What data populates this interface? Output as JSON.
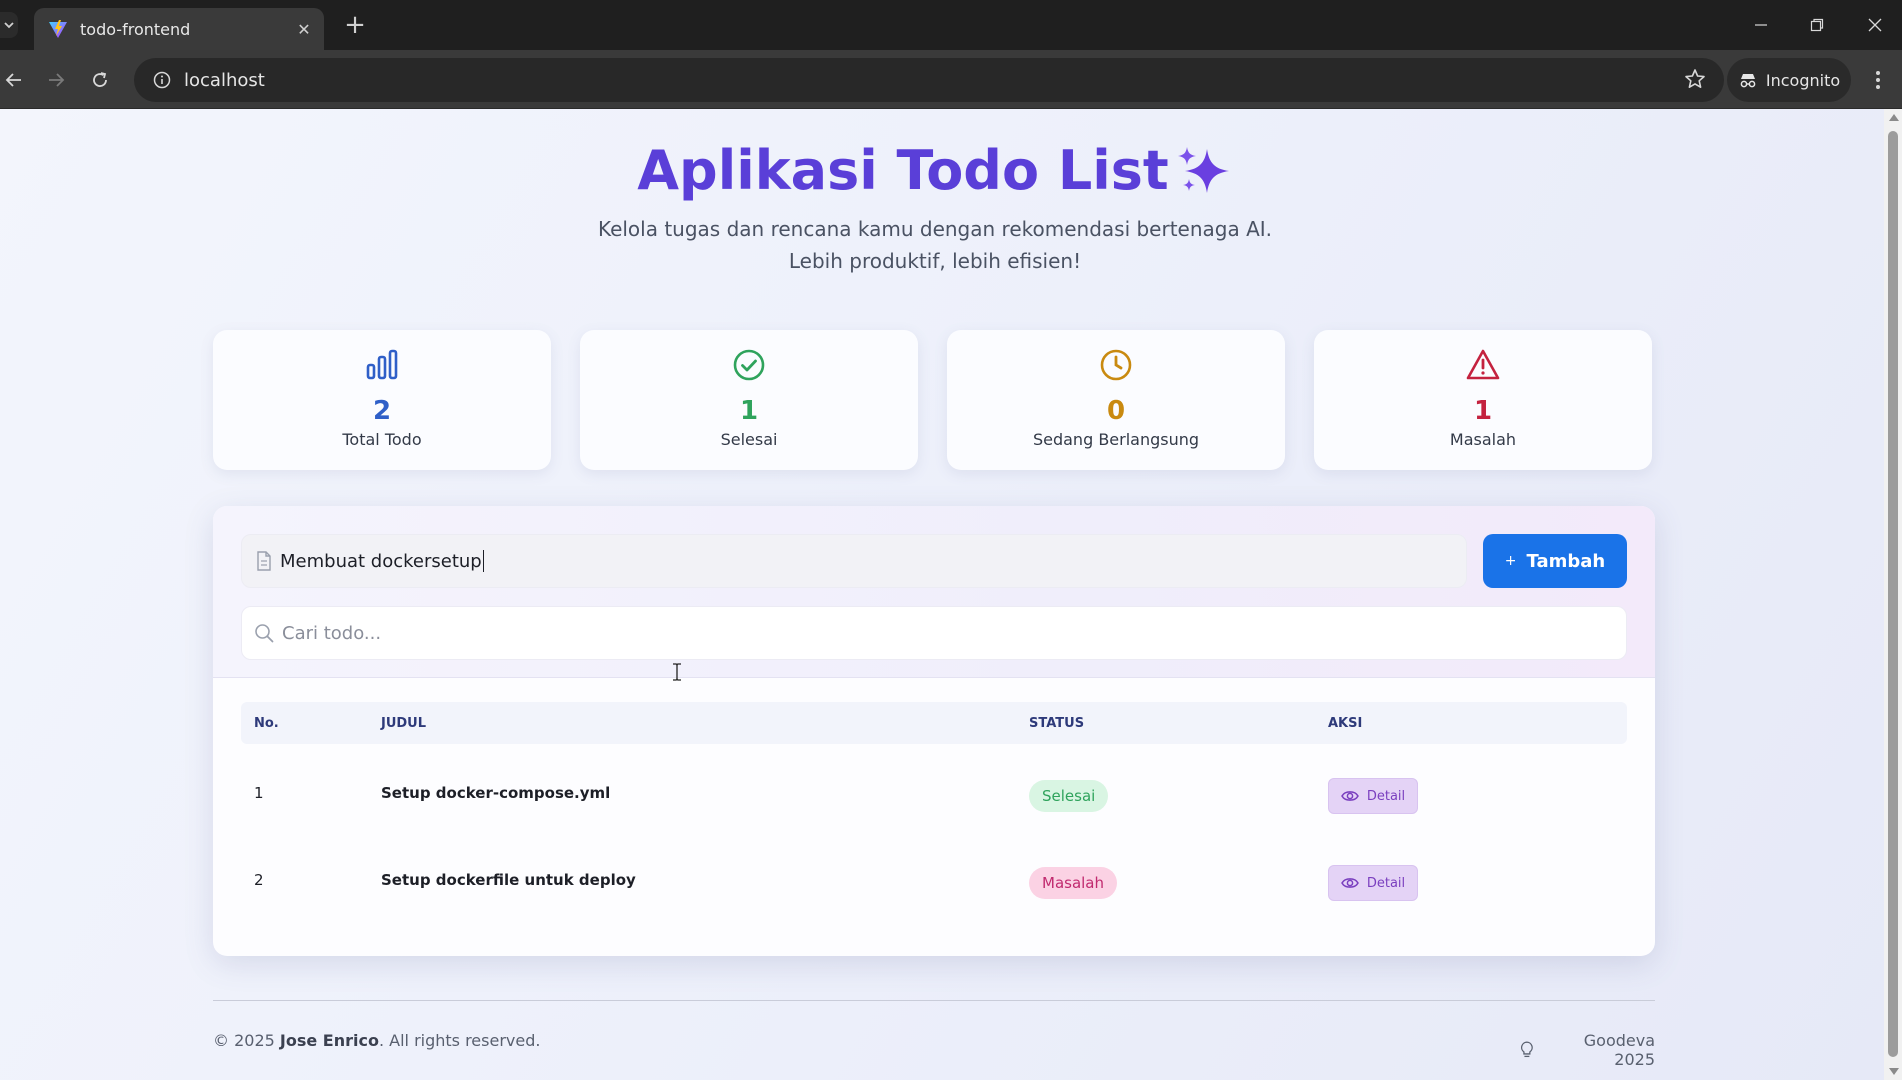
{
  "browser": {
    "tab_title": "todo-frontend",
    "url": "localhost",
    "incognito_label": "Incognito"
  },
  "hero": {
    "title": "Aplikasi Todo List",
    "subtitle": "Kelola tugas dan rencana kamu dengan rekomendasi bertenaga AI. Lebih produktif, lebih efisien!"
  },
  "stats": [
    {
      "icon": "bar-chart-icon",
      "value": "2",
      "label": "Total Todo",
      "color": "#2f5fc8"
    },
    {
      "icon": "check-circle-icon",
      "value": "1",
      "label": "Selesai",
      "color": "#2fa35c"
    },
    {
      "icon": "clock-icon",
      "value": "0",
      "label": "Sedang Berlangsung",
      "color": "#c98a10"
    },
    {
      "icon": "warning-triangle-icon",
      "value": "1",
      "label": "Masalah",
      "color": "#c4223f"
    }
  ],
  "form": {
    "todo_input_value": "Membuat dockersetup",
    "add_button_label": "Tambah",
    "search_placeholder": "Cari todo..."
  },
  "table": {
    "headers": [
      "No.",
      "JUDUL",
      "STATUS",
      "AKSI"
    ],
    "rows": [
      {
        "no": "1",
        "title": "Setup docker-compose.yml",
        "status": "Selesai",
        "action": "Detail"
      },
      {
        "no": "2",
        "title": "Setup dockerfile untuk deploy",
        "status": "Masalah",
        "action": "Detail"
      }
    ]
  },
  "footer": {
    "copyright_prefix": "© 2025",
    "author": "Jose Enrico",
    "rights": ". All rights reserved.",
    "brand": "Goodeva 2025"
  },
  "colors": {
    "accent": "#5a3fd8",
    "primary_button": "#1a73e8",
    "status_done": "#2fa35c",
    "status_problem": "#c12a6f"
  }
}
